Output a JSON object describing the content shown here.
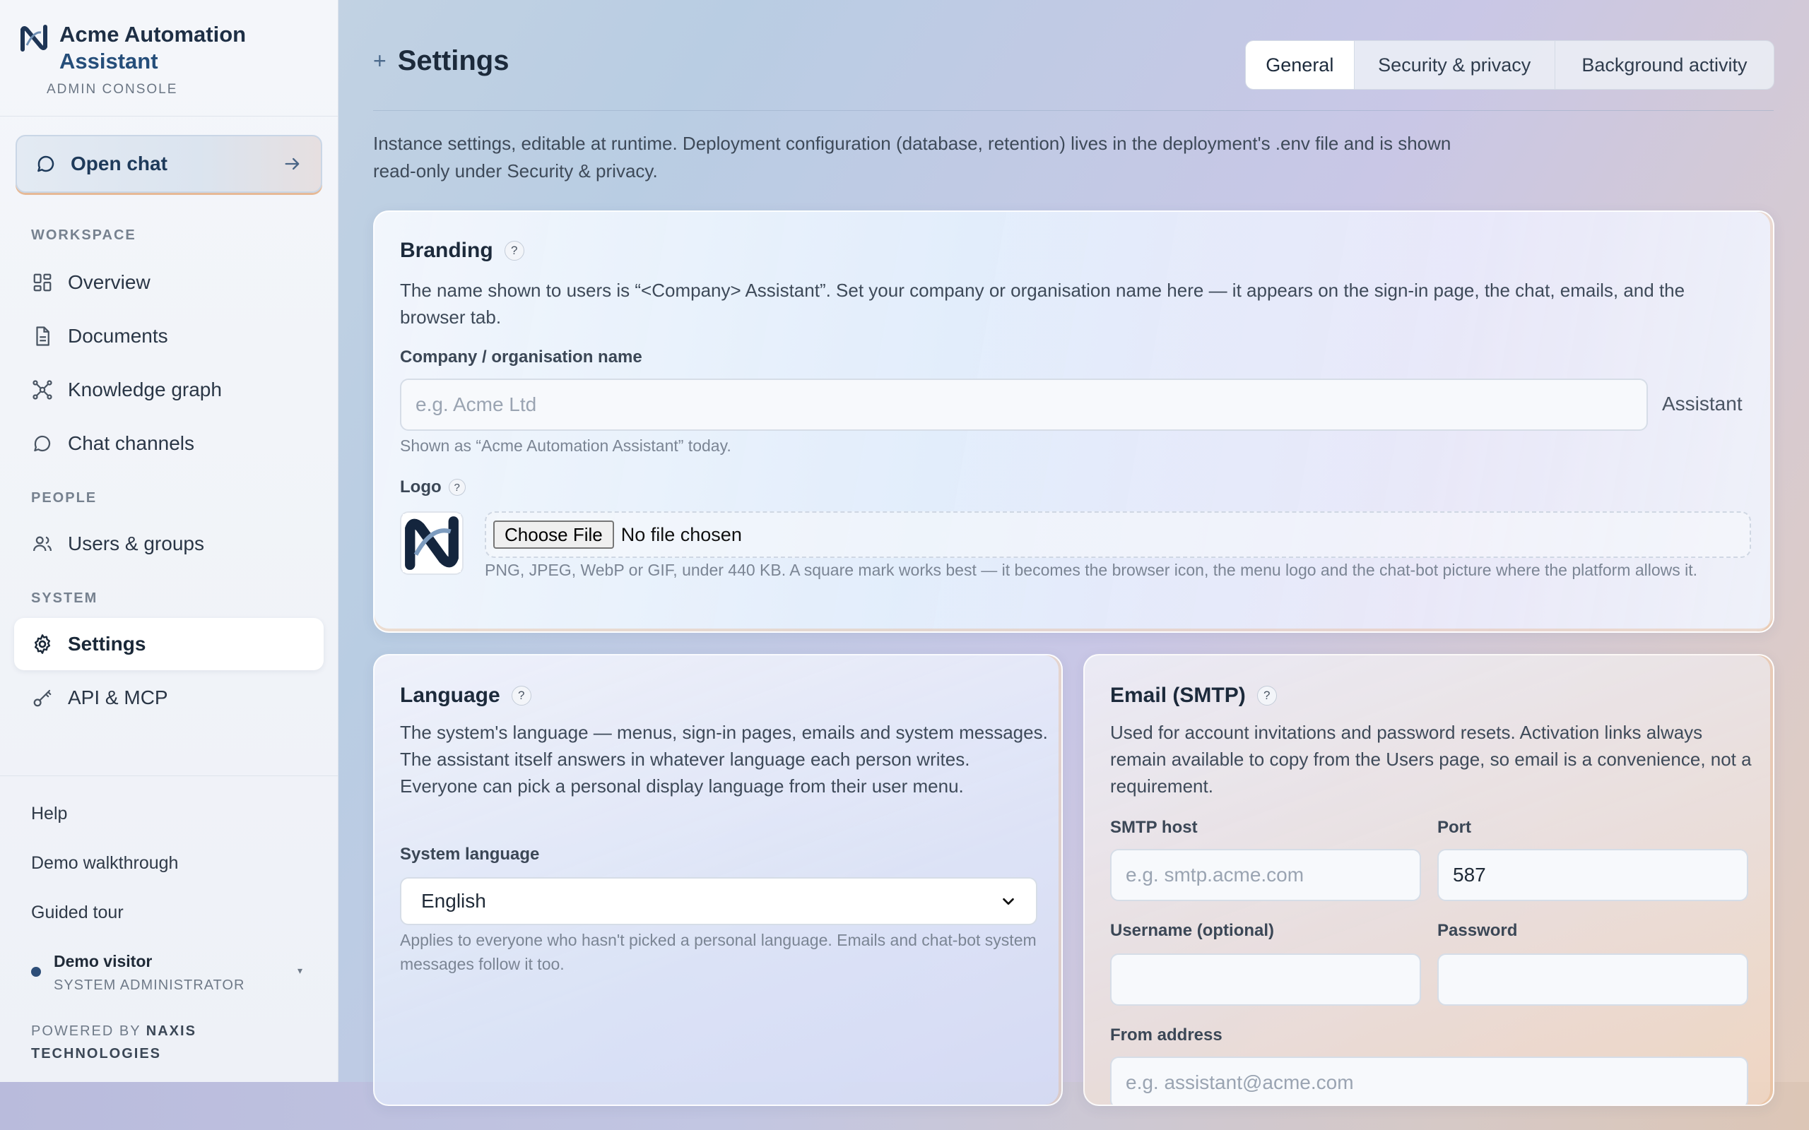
{
  "sidebar": {
    "brand_line1": "Acme Automation",
    "brand_line2": "Assistant",
    "brand_sub": "ADMIN CONSOLE",
    "open_chat": "Open chat",
    "sections": {
      "workspace": "WORKSPACE",
      "people": "PEOPLE",
      "system": "SYSTEM"
    },
    "items": {
      "overview": "Overview",
      "documents": "Documents",
      "knowledge_graph": "Knowledge graph",
      "chat_channels": "Chat channels",
      "users_groups": "Users & groups",
      "settings": "Settings",
      "api_mcp": "API & MCP"
    },
    "footer": {
      "help": "Help",
      "demo": "Demo walkthrough",
      "tour": "Guided tour"
    },
    "user": {
      "name": "Demo visitor",
      "role": "SYSTEM ADMINISTRATOR"
    },
    "powered_prefix": "POWERED BY ",
    "powered_brand": "NAXIS TECHNOLOGIES"
  },
  "header": {
    "title": "Settings",
    "tabs": {
      "general": "General",
      "security": "Security & privacy",
      "background": "Background activity"
    },
    "active_tab": "General",
    "intro": "Instance settings, editable at runtime. Deployment configuration (database, retention) lives in the deployment's .env file and is shown read-only under Security & privacy."
  },
  "branding": {
    "title": "Branding",
    "help": "?",
    "description": "The name shown to users is “<Company> Assistant”. Set your company or organisation name here — it appears on the sign-in page, the chat, emails, and the browser tab.",
    "company_label": "Company / organisation name",
    "company_placeholder": "e.g. Acme Ltd",
    "company_value": "",
    "suffix": "Assistant",
    "company_hint": "Shown as “Acme Automation Assistant” today.",
    "logo_label": "Logo",
    "file_button": "Choose File",
    "file_status": "No file chosen",
    "logo_hint": "PNG, JPEG, WebP or GIF, under 440 KB. A square mark works best — it becomes the browser icon, the menu logo and the chat-bot picture where the platform allows it."
  },
  "language": {
    "title": "Language",
    "help": "?",
    "description": "The system's language — menus, sign-in pages, emails and system messages. The assistant itself answers in whatever language each person writes. Everyone can pick a personal display language from their user menu.",
    "select_label": "System language",
    "selected": "English",
    "hint": "Applies to everyone who hasn't picked a personal language. Emails and chat-bot system messages follow it too."
  },
  "smtp": {
    "title": "Email (SMTP)",
    "help": "?",
    "description": "Used for account invitations and password resets. Activation links always remain available to copy from the Users page, so email is a convenience, not a requirement.",
    "host_label": "SMTP host",
    "host_placeholder": "e.g. smtp.acme.com",
    "port_label": "Port",
    "port_value": "587",
    "username_label": "Username (optional)",
    "username_value": "",
    "password_label": "Password",
    "password_value": "",
    "from_label": "From address",
    "from_placeholder": "e.g. assistant@acme.com"
  }
}
